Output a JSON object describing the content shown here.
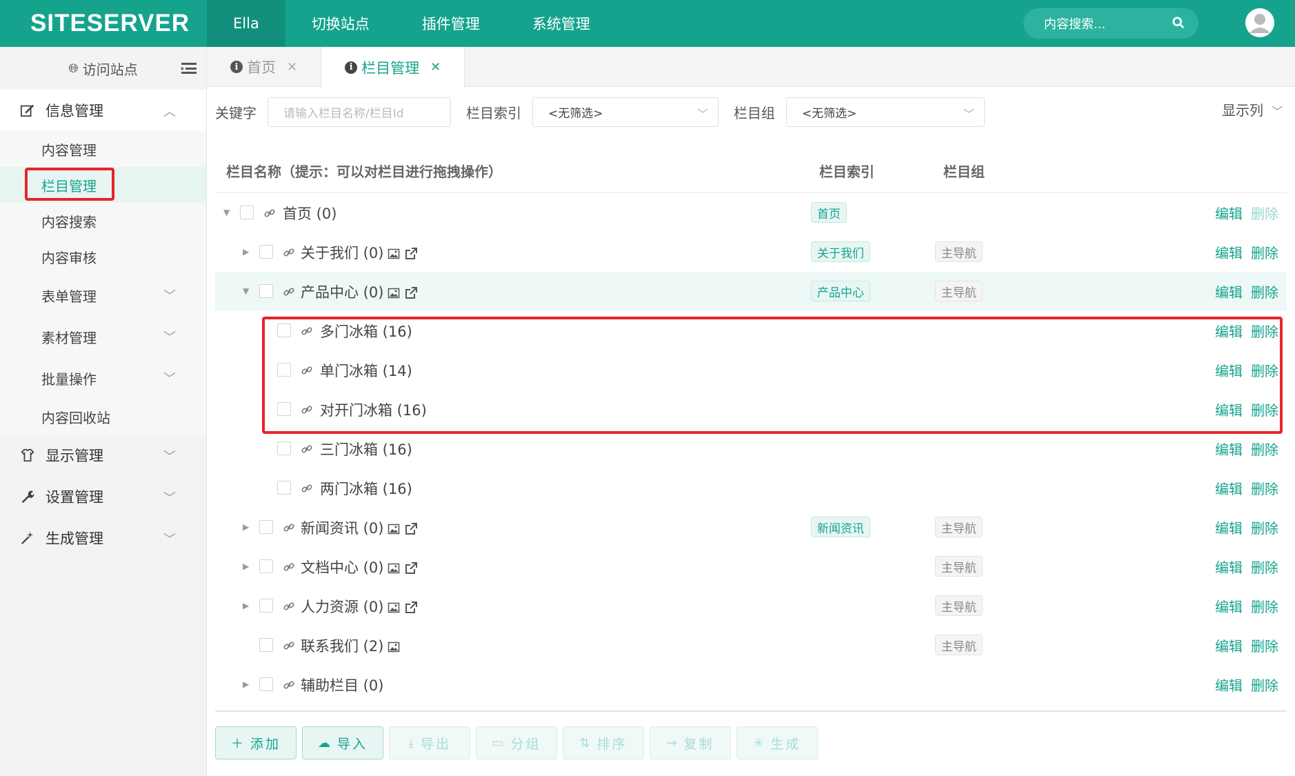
{
  "header": {
    "logo": "SITESERVER",
    "nav": [
      "Ella",
      "切换站点",
      "插件管理",
      "系统管理"
    ],
    "search_placeholder": "内容搜索..."
  },
  "sidebar": {
    "visit_site": "访问站点",
    "groups": [
      {
        "label": "信息管理",
        "icon": "edit-icon",
        "expanded": true,
        "items": [
          "内容管理",
          "栏目管理",
          "内容搜索",
          "内容审核",
          "表单管理",
          "素材管理",
          "批量操作",
          "内容回收站"
        ]
      },
      {
        "label": "显示管理",
        "icon": "shirt-icon"
      },
      {
        "label": "设置管理",
        "icon": "wrench-icon"
      },
      {
        "label": "生成管理",
        "icon": "magic-wand-icon"
      }
    ]
  },
  "tabs": [
    {
      "label": "首页",
      "active": false
    },
    {
      "label": "栏目管理",
      "active": true
    }
  ],
  "filters": {
    "keyword_label": "关键字",
    "keyword_placeholder": "请输入栏目名称/栏目Id",
    "index_label": "栏目索引",
    "index_value": "<无筛选>",
    "group_label": "栏目组",
    "group_value": "<无筛选>",
    "show_columns": "显示列"
  },
  "table": {
    "headers": {
      "name": "栏目名称（提示：可以对栏目进行拖拽操作）",
      "index": "栏目索引",
      "group": "栏目组"
    },
    "edit_label": "编辑",
    "delete_label": "删除",
    "rows": [
      {
        "name": "首页 (0)",
        "level": 0,
        "arrow": "down",
        "index": "首页",
        "group": "",
        "img": false,
        "ext": false,
        "delete_enabled": false
      },
      {
        "name": "关于我们 (0)",
        "level": 1,
        "arrow": "right",
        "index": "关于我们",
        "group": "主导航",
        "img": true,
        "ext": true,
        "delete_enabled": true
      },
      {
        "name": "产品中心 (0)",
        "level": 1,
        "arrow": "down",
        "index": "产品中心",
        "group": "主导航",
        "img": true,
        "ext": true,
        "delete_enabled": true
      },
      {
        "name": "多门冰箱 (16)",
        "level": 2,
        "arrow": "",
        "index": "",
        "group": "",
        "img": false,
        "ext": false,
        "delete_enabled": true
      },
      {
        "name": "单门冰箱 (14)",
        "level": 2,
        "arrow": "",
        "index": "",
        "group": "",
        "img": false,
        "ext": false,
        "delete_enabled": true
      },
      {
        "name": "对开门冰箱 (16)",
        "level": 2,
        "arrow": "",
        "index": "",
        "group": "",
        "img": false,
        "ext": false,
        "delete_enabled": true
      },
      {
        "name": "三门冰箱 (16)",
        "level": 2,
        "arrow": "",
        "index": "",
        "group": "",
        "img": false,
        "ext": false,
        "delete_enabled": true
      },
      {
        "name": "两门冰箱 (16)",
        "level": 2,
        "arrow": "",
        "index": "",
        "group": "",
        "img": false,
        "ext": false,
        "delete_enabled": true
      },
      {
        "name": "新闻资讯 (0)",
        "level": 1,
        "arrow": "right",
        "index": "新闻资讯",
        "group": "主导航",
        "img": true,
        "ext": true,
        "delete_enabled": true
      },
      {
        "name": "文档中心 (0)",
        "level": 1,
        "arrow": "right",
        "index": "",
        "group": "主导航",
        "img": true,
        "ext": true,
        "delete_enabled": true
      },
      {
        "name": "人力资源 (0)",
        "level": 1,
        "arrow": "right",
        "index": "",
        "group": "主导航",
        "img": true,
        "ext": true,
        "delete_enabled": true
      },
      {
        "name": "联系我们 (2)",
        "level": 1,
        "arrow": "",
        "index": "",
        "group": "主导航",
        "img": true,
        "ext": false,
        "delete_enabled": true
      },
      {
        "name": "辅助栏目 (0)",
        "level": 1,
        "arrow": "right",
        "index": "",
        "group": "",
        "img": false,
        "ext": false,
        "delete_enabled": true
      }
    ]
  },
  "buttons": [
    {
      "label": "添加",
      "icon": "plus-icon",
      "enabled": true
    },
    {
      "label": "导入",
      "icon": "cloud-upload-icon",
      "enabled": true
    },
    {
      "label": "导出",
      "icon": "download-icon",
      "enabled": false
    },
    {
      "label": "分组",
      "icon": "group-icon",
      "enabled": false
    },
    {
      "label": "排序",
      "icon": "sort-icon",
      "enabled": false
    },
    {
      "label": "复制",
      "icon": "arrow-right-icon",
      "enabled": false
    },
    {
      "label": "生成",
      "icon": "spinner-icon",
      "enabled": false
    }
  ],
  "colors": {
    "brand": "#15a38e",
    "highlight": "#e8242a"
  }
}
